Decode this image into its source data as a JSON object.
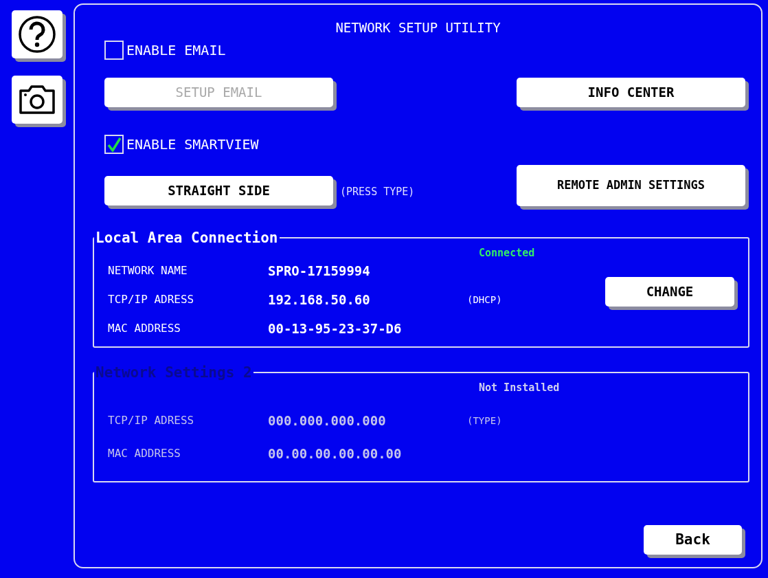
{
  "side_buttons": [
    {
      "kind": "help"
    },
    {
      "kind": "camera"
    }
  ],
  "title": "NETWORK SETUP UTILITY",
  "options": [
    {
      "label": "ENABLE EMAIL",
      "checked": false
    },
    {
      "label": "ENABLE SMARTVIEW",
      "checked": true
    }
  ],
  "setup_email": {
    "label": "SETUP EMAIL",
    "disabled": true
  },
  "info_center": {
    "label": "INFO CENTER"
  },
  "press_type": {
    "label": "STRAIGHT SIDE",
    "note": "(PRESS TYPE)"
  },
  "remote_admin": {
    "label": "REMOTE ADMIN SETTINGS"
  },
  "sections": [
    {
      "title": "Local Area Connection",
      "disabled": false,
      "status": "Connected",
      "action": "CHANGE",
      "rows": [
        {
          "label": "NETWORK NAME",
          "value": "SPRO-17159994"
        },
        {
          "label": "TCP/IP ADRESS",
          "value": "192.168.50.60",
          "note": "(DHCP)"
        },
        {
          "label": "MAC ADDRESS",
          "value": "00-13-95-23-37-D6"
        }
      ]
    },
    {
      "title": "Network Settings 2",
      "disabled": true,
      "status": "Not Installed",
      "rows": [
        {
          "label": "TCP/IP ADRESS",
          "value": "000.000.000.000",
          "note": "(TYPE)"
        },
        {
          "label": "MAC ADDRESS",
          "value": "00.00.00.00.00.00"
        }
      ]
    }
  ],
  "back": {
    "label": "Back"
  }
}
